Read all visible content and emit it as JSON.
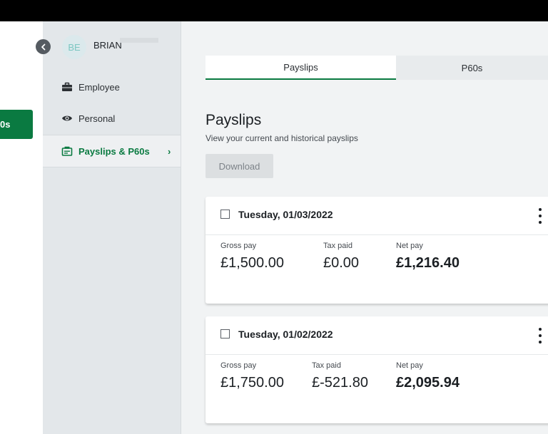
{
  "user": {
    "initials": "BE",
    "name": "BRIAN"
  },
  "rail": {
    "active_label": "0s"
  },
  "sidebar": {
    "items": [
      {
        "label": "Employee",
        "icon": "briefcase-icon"
      },
      {
        "label": "Personal",
        "icon": "eye-icon"
      },
      {
        "label": "Payslips & P60s",
        "icon": "payslip-icon",
        "active": true
      }
    ]
  },
  "tabs": [
    {
      "label": "Payslips",
      "active": true
    },
    {
      "label": "P60s",
      "active": false
    }
  ],
  "page": {
    "title": "Payslips",
    "subtitle": "View your current and historical payslips",
    "download_label": "Download"
  },
  "payslips": [
    {
      "date": "Tuesday, 01/03/2022",
      "gross_label": "Gross pay",
      "gross": "£1,500.00",
      "tax_label": "Tax paid",
      "tax": "£0.00",
      "net_label": "Net pay",
      "net": "£1,216.40"
    },
    {
      "date": "Tuesday, 01/02/2022",
      "gross_label": "Gross pay",
      "gross": "£1,750.00",
      "tax_label": "Tax paid",
      "tax": "£-521.80",
      "net_label": "Net pay",
      "net": "£2,095.94"
    }
  ],
  "colors": {
    "accent": "#0a7a41",
    "sidebar_bg": "#e3e7ea",
    "page_bg": "#f1f3f4"
  }
}
